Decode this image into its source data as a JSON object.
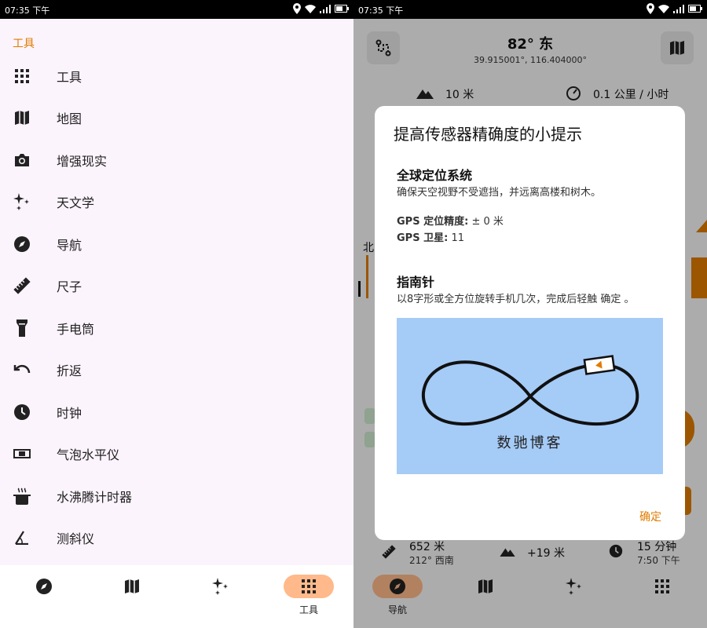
{
  "left": {
    "status": {
      "time": "07:35 下午"
    },
    "section_title": "工具",
    "menu": [
      {
        "icon": "grid-icon",
        "label": "工具"
      },
      {
        "icon": "map-icon",
        "label": "地图"
      },
      {
        "icon": "camera-icon",
        "label": "增强现实"
      },
      {
        "icon": "sparkles-icon",
        "label": "天文学"
      },
      {
        "icon": "compass-icon",
        "label": "导航"
      },
      {
        "icon": "ruler-icon",
        "label": "尺子"
      },
      {
        "icon": "flashlight-icon",
        "label": "手电筒"
      },
      {
        "icon": "undo-icon",
        "label": "折返"
      },
      {
        "icon": "clock-icon",
        "label": "时钟"
      },
      {
        "icon": "bubble-level-icon",
        "label": "气泡水平仪"
      },
      {
        "icon": "boiling-pot-icon",
        "label": "水沸腾计时器"
      },
      {
        "icon": "angle-icon",
        "label": "测斜仪"
      }
    ],
    "nav": {
      "active_label": "工具"
    }
  },
  "right": {
    "status": {
      "time": "07:35 下午"
    },
    "bearing": "82°   东",
    "coords": "39.915001°, 116.404000°",
    "altitude": "10 米",
    "speed": "0.1 公里 / 小时",
    "dialog": {
      "title": "提高传感器精确度的小提示",
      "gps_heading": "全球定位系统",
      "gps_text": "确保天空视野不受遮挡，并远离高楼和树木。",
      "gps_accuracy_label": "GPS 定位精度:",
      "gps_accuracy_value": "± 0 米",
      "gps_sat_label": "GPS 卫星:",
      "gps_sat_value": "11",
      "compass_heading": "指南针",
      "compass_text": "以8字形或全方位旋转手机几次，完成后轻触 确定 。",
      "figure_caption": "数驰博客",
      "ok": "确定"
    },
    "bg_north": "北",
    "nav_info": {
      "distance": "652 米",
      "direction": "212° 西南",
      "elevation": "+19 米",
      "eta": "15 分钟",
      "arrival": "7:50 下午"
    },
    "nav": {
      "active_label": "导航"
    }
  },
  "colors": {
    "accent": "#e07b00",
    "nav_active": "#ffb98a",
    "figure_bg": "#a5cbf7"
  }
}
